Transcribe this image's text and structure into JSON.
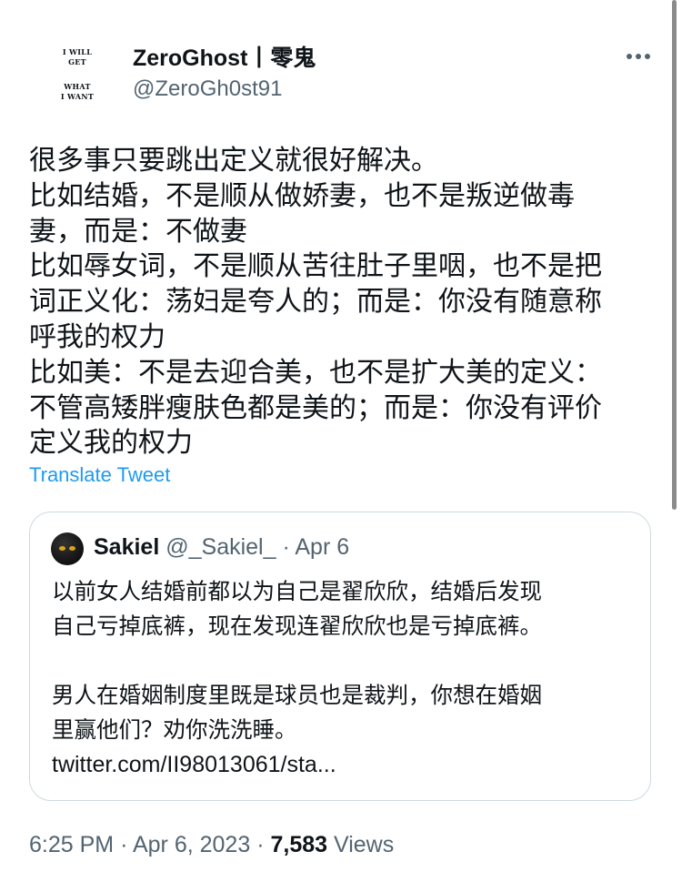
{
  "author": {
    "avatar_lines_top": [
      "I WILL",
      "GET"
    ],
    "avatar_lines_bottom": [
      "WHAT",
      "I WANT"
    ],
    "display_name": "ZeroGhost丨零鬼",
    "handle": "@ZeroGh0st91"
  },
  "more_icon": "more-horizontal-icon",
  "tweet_lines": [
    "很多事只要跳出定义就很好解决。",
    "比如结婚，不是顺从做娇妻，也不是叛逆做毒",
    "妻，而是：不做妻",
    "比如辱女词，不是顺从苦往肚子里咽，也不是把",
    "词正义化：荡妇是夸人的；而是：你没有随意称",
    "呼我的权力",
    "比如美：不是去迎合美，也不是扩大美的定义：",
    "不管高矮胖瘦肤色都是美的；而是：你没有评价",
    "定义我的权力"
  ],
  "translate_label": "Translate Tweet",
  "quote": {
    "name": "Sakiel",
    "handle": "@_Sakiel_",
    "separator": "·",
    "date": "Apr 6",
    "lines": [
      "以前女人结婚前都以为自己是翟欣欣，结婚后发现",
      "自己亏掉底裤，现在发现连翟欣欣也是亏掉底裤。",
      "",
      "男人在婚姻制度里既是球员也是裁判，你想在婚姻",
      "里赢他们？劝你洗洗睡。"
    ],
    "link": "twitter.com/II98013061/sta..."
  },
  "footer": {
    "time": "6:25 PM",
    "sep1": "·",
    "date": "Apr 6, 2023",
    "sep2": "·",
    "views_count": "7,583",
    "views_label": "Views"
  },
  "colors": {
    "text": "#0f1419",
    "secondary": "#536471",
    "link": "#1d9bf0",
    "border": "#cfd9de"
  }
}
